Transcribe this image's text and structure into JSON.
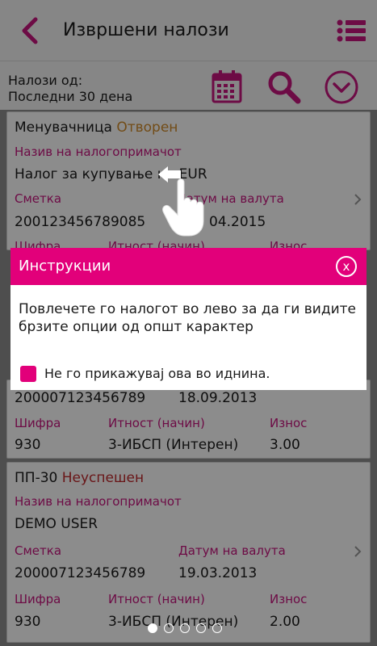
{
  "header": {
    "title": "Извршени налози"
  },
  "filter": {
    "line1": "Налози од:",
    "line2": "Последни 30 дена"
  },
  "cards": [
    {
      "type": "Менувачница",
      "status": "Отворен",
      "payee_label": "Назив на налогопримачот",
      "payee": "Налог за купување на EUR",
      "account_label": "Сметка",
      "account": "200123456789085",
      "date_label": "Датум на валута",
      "date": "04.2015",
      "code_label": "Шифра",
      "purpose_label": "Итност (начин)",
      "amount_label": "Износ"
    },
    {
      "account": "200007123456789",
      "date": "18.09.2013",
      "code_label": "Шифра",
      "code": "930",
      "purpose_label": "Итност (начин)",
      "purpose": "3-ИБСП (Интерен)",
      "amount_label": "Износ",
      "amount": "3.00"
    },
    {
      "type": "ПП-30",
      "status": "Неуспешен",
      "payee_label": "Назив на налогопримачот",
      "payee": "DEMO USER",
      "account_label": "Сметка",
      "account": "200007123456789",
      "date_label": "Датум на валута",
      "date": "19.03.2013",
      "code_label": "Шифра",
      "code": "930",
      "purpose_label": "Итност (начин)",
      "purpose": "3-ИБСП (Интерен)",
      "amount_label": "Износ",
      "amount": "2.00"
    }
  ],
  "modal": {
    "title": "Инструкции",
    "close": "x",
    "message": "Повлечете го налогот во лево за да ги видите брзите опции од општ карактер",
    "checkbox_label": "Не го прикажувај ова во иднина."
  },
  "icons": [
    "back-arrow-icon",
    "list-menu-icon",
    "calendar-icon",
    "search-icon",
    "dropdown-circle-icon",
    "swipe-hand-icon"
  ],
  "colors": {
    "accent": "#e2007a",
    "status_open": "#d08a2a",
    "status_failed": "#c0292d"
  },
  "pager": {
    "pages": 5,
    "active": 1
  }
}
